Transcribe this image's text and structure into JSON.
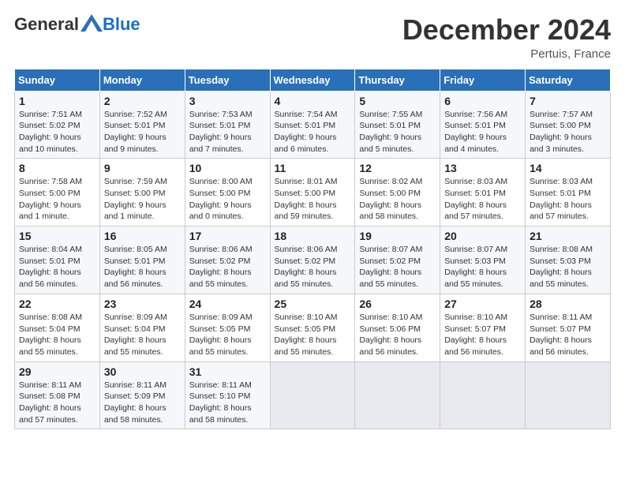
{
  "header": {
    "logo_general": "General",
    "logo_blue": "Blue",
    "month_title": "December 2024",
    "location": "Pertuis, France"
  },
  "weekdays": [
    "Sunday",
    "Monday",
    "Tuesday",
    "Wednesday",
    "Thursday",
    "Friday",
    "Saturday"
  ],
  "weeks": [
    [
      {
        "day": "1",
        "sunrise": "Sunrise: 7:51 AM",
        "sunset": "Sunset: 5:02 PM",
        "daylight": "Daylight: 9 hours and 10 minutes."
      },
      {
        "day": "2",
        "sunrise": "Sunrise: 7:52 AM",
        "sunset": "Sunset: 5:01 PM",
        "daylight": "Daylight: 9 hours and 9 minutes."
      },
      {
        "day": "3",
        "sunrise": "Sunrise: 7:53 AM",
        "sunset": "Sunset: 5:01 PM",
        "daylight": "Daylight: 9 hours and 7 minutes."
      },
      {
        "day": "4",
        "sunrise": "Sunrise: 7:54 AM",
        "sunset": "Sunset: 5:01 PM",
        "daylight": "Daylight: 9 hours and 6 minutes."
      },
      {
        "day": "5",
        "sunrise": "Sunrise: 7:55 AM",
        "sunset": "Sunset: 5:01 PM",
        "daylight": "Daylight: 9 hours and 5 minutes."
      },
      {
        "day": "6",
        "sunrise": "Sunrise: 7:56 AM",
        "sunset": "Sunset: 5:01 PM",
        "daylight": "Daylight: 9 hours and 4 minutes."
      },
      {
        "day": "7",
        "sunrise": "Sunrise: 7:57 AM",
        "sunset": "Sunset: 5:00 PM",
        "daylight": "Daylight: 9 hours and 3 minutes."
      }
    ],
    [
      {
        "day": "8",
        "sunrise": "Sunrise: 7:58 AM",
        "sunset": "Sunset: 5:00 PM",
        "daylight": "Daylight: 9 hours and 1 minute."
      },
      {
        "day": "9",
        "sunrise": "Sunrise: 7:59 AM",
        "sunset": "Sunset: 5:00 PM",
        "daylight": "Daylight: 9 hours and 1 minute."
      },
      {
        "day": "10",
        "sunrise": "Sunrise: 8:00 AM",
        "sunset": "Sunset: 5:00 PM",
        "daylight": "Daylight: 9 hours and 0 minutes."
      },
      {
        "day": "11",
        "sunrise": "Sunrise: 8:01 AM",
        "sunset": "Sunset: 5:00 PM",
        "daylight": "Daylight: 8 hours and 59 minutes."
      },
      {
        "day": "12",
        "sunrise": "Sunrise: 8:02 AM",
        "sunset": "Sunset: 5:00 PM",
        "daylight": "Daylight: 8 hours and 58 minutes."
      },
      {
        "day": "13",
        "sunrise": "Sunrise: 8:03 AM",
        "sunset": "Sunset: 5:01 PM",
        "daylight": "Daylight: 8 hours and 57 minutes."
      },
      {
        "day": "14",
        "sunrise": "Sunrise: 8:03 AM",
        "sunset": "Sunset: 5:01 PM",
        "daylight": "Daylight: 8 hours and 57 minutes."
      }
    ],
    [
      {
        "day": "15",
        "sunrise": "Sunrise: 8:04 AM",
        "sunset": "Sunset: 5:01 PM",
        "daylight": "Daylight: 8 hours and 56 minutes."
      },
      {
        "day": "16",
        "sunrise": "Sunrise: 8:05 AM",
        "sunset": "Sunset: 5:01 PM",
        "daylight": "Daylight: 8 hours and 56 minutes."
      },
      {
        "day": "17",
        "sunrise": "Sunrise: 8:06 AM",
        "sunset": "Sunset: 5:02 PM",
        "daylight": "Daylight: 8 hours and 55 minutes."
      },
      {
        "day": "18",
        "sunrise": "Sunrise: 8:06 AM",
        "sunset": "Sunset: 5:02 PM",
        "daylight": "Daylight: 8 hours and 55 minutes."
      },
      {
        "day": "19",
        "sunrise": "Sunrise: 8:07 AM",
        "sunset": "Sunset: 5:02 PM",
        "daylight": "Daylight: 8 hours and 55 minutes."
      },
      {
        "day": "20",
        "sunrise": "Sunrise: 8:07 AM",
        "sunset": "Sunset: 5:03 PM",
        "daylight": "Daylight: 8 hours and 55 minutes."
      },
      {
        "day": "21",
        "sunrise": "Sunrise: 8:08 AM",
        "sunset": "Sunset: 5:03 PM",
        "daylight": "Daylight: 8 hours and 55 minutes."
      }
    ],
    [
      {
        "day": "22",
        "sunrise": "Sunrise: 8:08 AM",
        "sunset": "Sunset: 5:04 PM",
        "daylight": "Daylight: 8 hours and 55 minutes."
      },
      {
        "day": "23",
        "sunrise": "Sunrise: 8:09 AM",
        "sunset": "Sunset: 5:04 PM",
        "daylight": "Daylight: 8 hours and 55 minutes."
      },
      {
        "day": "24",
        "sunrise": "Sunrise: 8:09 AM",
        "sunset": "Sunset: 5:05 PM",
        "daylight": "Daylight: 8 hours and 55 minutes."
      },
      {
        "day": "25",
        "sunrise": "Sunrise: 8:10 AM",
        "sunset": "Sunset: 5:05 PM",
        "daylight": "Daylight: 8 hours and 55 minutes."
      },
      {
        "day": "26",
        "sunrise": "Sunrise: 8:10 AM",
        "sunset": "Sunset: 5:06 PM",
        "daylight": "Daylight: 8 hours and 56 minutes."
      },
      {
        "day": "27",
        "sunrise": "Sunrise: 8:10 AM",
        "sunset": "Sunset: 5:07 PM",
        "daylight": "Daylight: 8 hours and 56 minutes."
      },
      {
        "day": "28",
        "sunrise": "Sunrise: 8:11 AM",
        "sunset": "Sunset: 5:07 PM",
        "daylight": "Daylight: 8 hours and 56 minutes."
      }
    ],
    [
      {
        "day": "29",
        "sunrise": "Sunrise: 8:11 AM",
        "sunset": "Sunset: 5:08 PM",
        "daylight": "Daylight: 8 hours and 57 minutes."
      },
      {
        "day": "30",
        "sunrise": "Sunrise: 8:11 AM",
        "sunset": "Sunset: 5:09 PM",
        "daylight": "Daylight: 8 hours and 58 minutes."
      },
      {
        "day": "31",
        "sunrise": "Sunrise: 8:11 AM",
        "sunset": "Sunset: 5:10 PM",
        "daylight": "Daylight: 8 hours and 58 minutes."
      },
      null,
      null,
      null,
      null
    ]
  ]
}
